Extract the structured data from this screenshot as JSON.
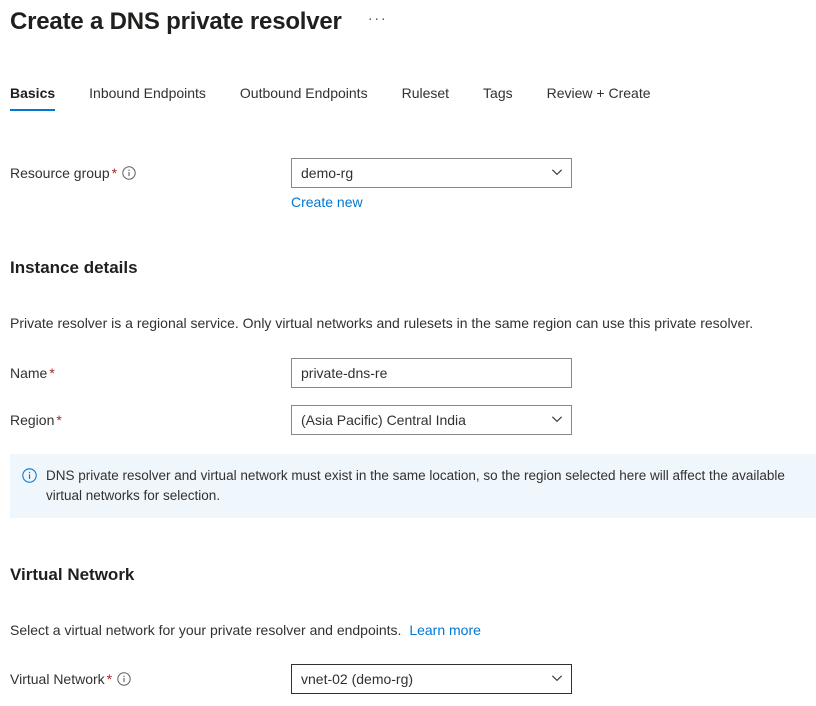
{
  "header": {
    "title": "Create a DNS private resolver",
    "more_actions": "···"
  },
  "tabs": [
    {
      "label": "Basics",
      "active": true
    },
    {
      "label": "Inbound Endpoints",
      "active": false
    },
    {
      "label": "Outbound Endpoints",
      "active": false
    },
    {
      "label": "Ruleset",
      "active": false
    },
    {
      "label": "Tags",
      "active": false
    },
    {
      "label": "Review + Create",
      "active": false
    }
  ],
  "resource_group": {
    "label": "Resource group",
    "required_marker": "*",
    "value": "demo-rg",
    "create_new_label": "Create new"
  },
  "instance_details": {
    "heading": "Instance details",
    "description": "Private resolver is a regional service. Only virtual networks and rulesets in the same region can use this private resolver.",
    "name": {
      "label": "Name",
      "required_marker": "*",
      "value": "private-dns-re",
      "placeholder": ""
    },
    "region": {
      "label": "Region",
      "required_marker": "*",
      "value": "(Asia Pacific) Central India"
    }
  },
  "info_banner": {
    "icon": "info-icon",
    "text": "DNS private resolver and virtual network must exist in the same location, so the region selected here will affect the available virtual networks for selection."
  },
  "virtual_network": {
    "heading": "Virtual Network",
    "description": "Select a virtual network for your private resolver and endpoints.",
    "learn_more_label": "Learn more",
    "field": {
      "label": "Virtual Network",
      "required_marker": "*",
      "value": "vnet-02 (demo-rg)"
    }
  },
  "colors": {
    "accent": "#0078d4",
    "required": "#a4262c",
    "banner_bg": "#eff6fc",
    "text": "#323130",
    "border": "#8a8886"
  }
}
